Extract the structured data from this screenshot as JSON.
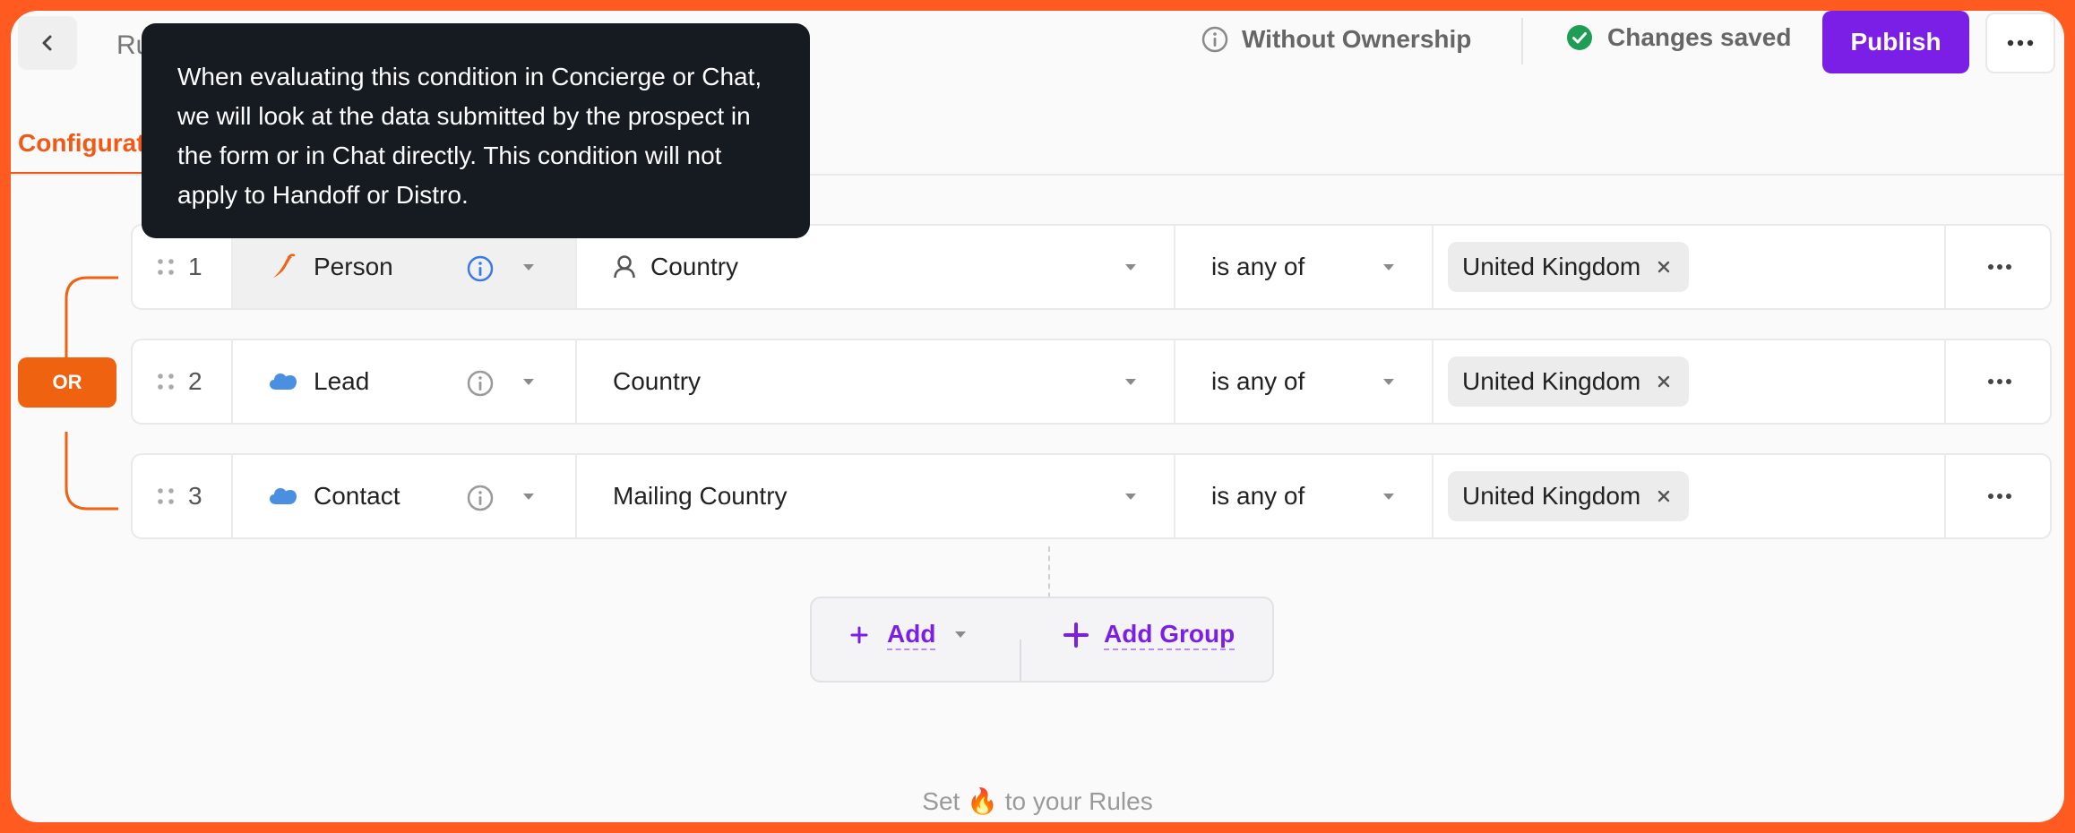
{
  "header": {
    "title_stub": "Ru",
    "ownership_label": "Without Ownership",
    "saved_label": "Changes saved",
    "publish_label": "Publish"
  },
  "tabs": {
    "active_label": "Configurati"
  },
  "tooltip": {
    "text": "When evaluating this condition in Concierge or Chat, we will look at the data submitted by the prospect in the form or in Chat directly. This condition will not apply to Handoff or Distro."
  },
  "group": {
    "operator": "OR"
  },
  "conditions": [
    {
      "index": "1",
      "object": "Person",
      "object_icon": "chilipiper-icon",
      "field": "Country",
      "field_icon": "person-icon",
      "operator": "is any of",
      "value": "United Kingdom"
    },
    {
      "index": "2",
      "object": "Lead",
      "object_icon": "salesforce-cloud-icon",
      "field": "Country",
      "operator": "is any of",
      "value": "United Kingdom"
    },
    {
      "index": "3",
      "object": "Contact",
      "object_icon": "salesforce-cloud-icon",
      "field": "Mailing Country",
      "operator": "is any of",
      "value": "United Kingdom"
    }
  ],
  "actions": {
    "add_label": "Add",
    "add_group_label": "Add Group"
  },
  "footer": {
    "hint_before": "Set",
    "hint_emoji": "🔥",
    "hint_after": "to your Rules"
  },
  "colors": {
    "accent_orange": "#f05a16",
    "accent_purple": "#7b1fe6",
    "success_green": "#1f9d55",
    "salesforce_blue": "#4a90e2"
  }
}
